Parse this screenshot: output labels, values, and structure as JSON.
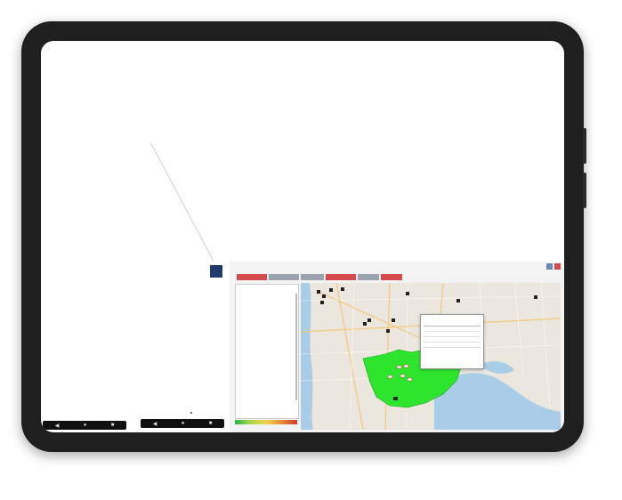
{
  "window": {
    "title": ""
  },
  "tabs": [
    {
      "label": "",
      "color": "#d54a4a"
    },
    {
      "label": "",
      "color": "#9aa3ad"
    },
    {
      "label": "",
      "color": "#9aa3ad"
    },
    {
      "label": "",
      "color": "#d54a4a"
    },
    {
      "label": "",
      "color": "#9aa3ad"
    },
    {
      "label": "",
      "color": "#d54a4a"
    }
  ],
  "sidebar": {
    "title": "",
    "items": [
      "",
      "",
      "",
      "",
      "",
      "",
      "",
      "",
      "",
      "",
      "",
      "",
      "",
      "",
      "",
      "",
      "",
      "",
      "",
      "",
      "",
      "",
      "",
      "",
      "",
      "",
      "",
      "",
      ""
    ]
  },
  "popup": {
    "title": "",
    "header": "",
    "rows": [
      {
        "label": "",
        "value": ""
      },
      {
        "label": "",
        "value": ""
      },
      {
        "label": "",
        "value": ""
      },
      {
        "label": "",
        "value": ""
      }
    ]
  },
  "bottom_buttons": [
    "",
    "",
    ""
  ],
  "colors": {
    "accent_red": "#d54a4a",
    "highlight_green": "#2ee52e",
    "tablet_frame": "#1f1f1f"
  },
  "icons": [
    "marker-icon",
    "close-icon"
  ]
}
